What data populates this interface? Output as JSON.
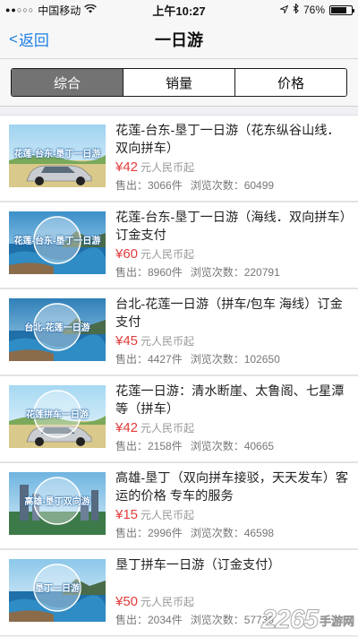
{
  "status_bar": {
    "carrier": "中国移动",
    "time": "上午10:27",
    "battery": "76%",
    "battery_level": 0.76
  },
  "nav": {
    "back_label": "返回",
    "title": "一日游"
  },
  "tabs": [
    {
      "label": "综合",
      "active": true
    },
    {
      "label": "销量",
      "active": false
    },
    {
      "label": "价格",
      "active": false
    }
  ],
  "items": [
    {
      "title": "花莲-台东-垦丁一日游（花东纵谷山线．双向拼车）",
      "price": "¥42",
      "unit": "元人民币起",
      "sold": "售出：3066件",
      "views": "浏览次数：60499",
      "thumb_text": "花莲-台东-垦丁一日游",
      "thumb_type": "car"
    },
    {
      "title": "花莲-台东-垦丁一日游（海线．双向拼车）订金支付",
      "price": "¥60",
      "unit": "元人民币起",
      "sold": "售出：8960件",
      "views": "浏览次数：220791",
      "thumb_text": "花莲-台东-垦丁一日游",
      "thumb_type": "sea"
    },
    {
      "title": "台北-花莲一日游（拼车/包车 海线）订金支付",
      "price": "¥45",
      "unit": "元人民币起",
      "sold": "售出：4427件",
      "views": "浏览次数：102650",
      "thumb_text": "台北-花莲一日游",
      "thumb_type": "coast"
    },
    {
      "title": "花莲一日游：清水断崖、太鲁阁、七星潭等（拼车）",
      "price": "¥42",
      "unit": "元人民币起",
      "sold": "售出：2158件",
      "views": "浏览次数：40665",
      "thumb_text": "花莲拼车一日游",
      "thumb_type": "car2"
    },
    {
      "title": "高雄-垦丁（双向拼车接驳，天天发车）客运的价格 专车的服务",
      "price": "¥15",
      "unit": "元人民币起",
      "sold": "售出：2996件",
      "views": "浏览次数：46598",
      "thumb_text": "高雄-垦丁双向游",
      "thumb_type": "city"
    },
    {
      "title": "垦丁拼车一日游（订金支付）",
      "price": "¥50",
      "unit": "元人民币起",
      "sold": "售出：2034件",
      "views": "浏览次数：57739",
      "thumb_text": "垦丁一日游",
      "thumb_type": "rock"
    }
  ],
  "watermark": {
    "number": "2265",
    "suffix": "手游网"
  }
}
